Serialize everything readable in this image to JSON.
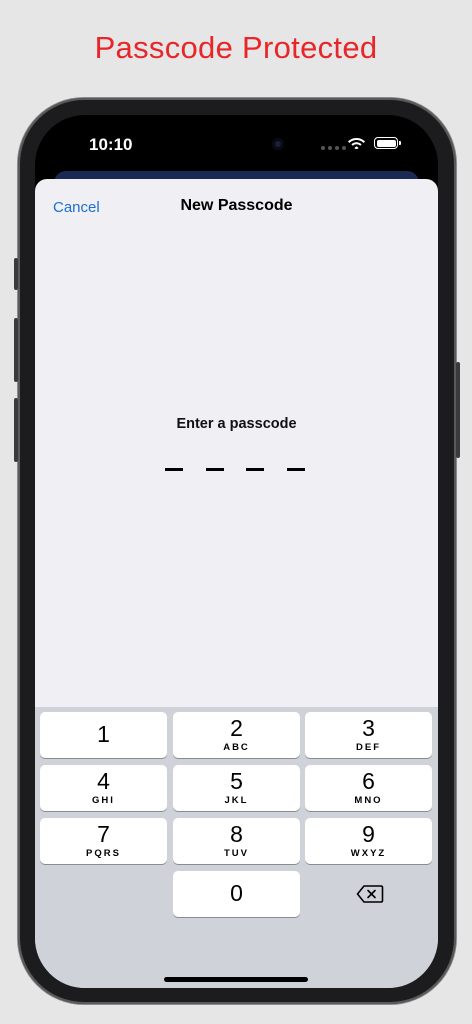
{
  "promo": {
    "title": "Passcode Protected"
  },
  "status_bar": {
    "time": "10:10"
  },
  "nav": {
    "cancel_label": "Cancel",
    "title": "New Passcode"
  },
  "passcode": {
    "prompt": "Enter a passcode",
    "slots": 4,
    "filled": 0
  },
  "keypad": {
    "keys": [
      {
        "digit": "1",
        "letters": ""
      },
      {
        "digit": "2",
        "letters": "ABC"
      },
      {
        "digit": "3",
        "letters": "DEF"
      },
      {
        "digit": "4",
        "letters": "GHI"
      },
      {
        "digit": "5",
        "letters": "JKL"
      },
      {
        "digit": "6",
        "letters": "MNO"
      },
      {
        "digit": "7",
        "letters": "PQRS"
      },
      {
        "digit": "8",
        "letters": "TUV"
      },
      {
        "digit": "9",
        "letters": "WXYZ"
      },
      {
        "digit": "0",
        "letters": ""
      }
    ],
    "delete_icon": "delete-backspace-icon"
  },
  "colors": {
    "promo_title": "#e8262a",
    "accent": "#1d6fd1",
    "sheet_background": "#efeff4",
    "keypad_background": "#cfd2d9"
  }
}
